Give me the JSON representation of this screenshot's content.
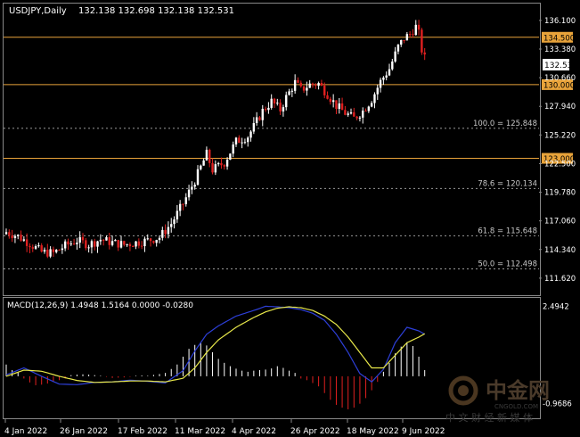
{
  "chart_data": [
    {
      "type": "candlestick",
      "title": "USDJPY,Daily",
      "ohlc_readout": "132.138 132.698 132.138 132.531",
      "last_price": "132.531",
      "ylim": [
        110.0,
        137.7
      ],
      "y_ticks": [
        "136.100",
        "133.380",
        "130.660",
        "127.940",
        "125.220",
        "122.500",
        "119.780",
        "117.060",
        "114.340",
        "111.620"
      ],
      "x_labels": [
        "4 Jan 2022",
        "26 Jan 2022",
        "17 Feb 2022",
        "11 Mar 2022",
        "4 Apr 2022",
        "26 Apr 2022",
        "18 May 2022",
        "9 Jun 2022"
      ],
      "horizontal_levels": [
        {
          "value": 134.5,
          "label": "134.500",
          "color": "#e8a33a"
        },
        {
          "value": 130.0,
          "label": "130.000",
          "color": "#e8a33a"
        },
        {
          "value": 123.0,
          "label": "123.000",
          "color": "#e8a33a"
        }
      ],
      "fibonacci_levels": [
        {
          "value": 125.848,
          "label": "100.0 = 125.848"
        },
        {
          "value": 120.134,
          "label": "78.6 = 120.134"
        },
        {
          "value": 115.648,
          "label": "61.8 = 115.648"
        },
        {
          "value": 112.498,
          "label": "50.0 = 112.498"
        }
      ],
      "close_path": [
        [
          0,
          116.0
        ],
        [
          4,
          115.6
        ],
        [
          8,
          114.9
        ],
        [
          12,
          114.1
        ],
        [
          16,
          114.0
        ],
        [
          20,
          114.7
        ],
        [
          24,
          115.2
        ],
        [
          28,
          114.8
        ],
        [
          32,
          115.3
        ],
        [
          36,
          115.0
        ],
        [
          40,
          114.8
        ],
        [
          44,
          115.0
        ],
        [
          48,
          115.2
        ],
        [
          52,
          115.5
        ],
        [
          56,
          116.8
        ],
        [
          60,
          118.7
        ],
        [
          64,
          120.9
        ],
        [
          68,
          123.4
        ],
        [
          70,
          121.9
        ],
        [
          74,
          122.6
        ],
        [
          78,
          124.6
        ],
        [
          82,
          125.1
        ],
        [
          84,
          126.0
        ],
        [
          87,
          127.5
        ],
        [
          90,
          128.4
        ],
        [
          93,
          127.6
        ],
        [
          95,
          128.8
        ],
        [
          98,
          130.2
        ],
        [
          100,
          129.5
        ],
        [
          103,
          130.0
        ],
        [
          106,
          130.1
        ],
        [
          109,
          129.1
        ],
        [
          112,
          128.0
        ],
        [
          115,
          127.3
        ],
        [
          118,
          126.8
        ],
        [
          121,
          127.5
        ],
        [
          124,
          128.6
        ],
        [
          127,
          130.3
        ],
        [
          130,
          131.5
        ],
        [
          133,
          133.6
        ],
        [
          135,
          134.4
        ],
        [
          137,
          134.8
        ],
        [
          139,
          135.5
        ],
        [
          140,
          134.8
        ],
        [
          141,
          133.3
        ],
        [
          142,
          132.5
        ]
      ],
      "accent": "#e8a33a",
      "bull_color": "#ffffff",
      "bear_color": "#e02020"
    },
    {
      "type": "macd",
      "label": "MACD(12,26,9) 1.4948 1.5164 0.0000 -0.0280",
      "ylim": [
        -1.5,
        2.8
      ],
      "y_ticks": [
        "2.4942",
        "-0.9686"
      ],
      "macd_path": [
        [
          0,
          0.05
        ],
        [
          6,
          0.3
        ],
        [
          12,
          0.0
        ],
        [
          18,
          -0.28
        ],
        [
          24,
          -0.3
        ],
        [
          30,
          -0.22
        ],
        [
          36,
          -0.2
        ],
        [
          42,
          -0.14
        ],
        [
          48,
          -0.18
        ],
        [
          54,
          -0.24
        ],
        [
          60,
          0.2
        ],
        [
          64,
          0.9
        ],
        [
          68,
          1.5
        ],
        [
          72,
          1.8
        ],
        [
          78,
          2.15
        ],
        [
          84,
          2.35
        ],
        [
          88,
          2.5
        ],
        [
          92,
          2.48
        ],
        [
          96,
          2.45
        ],
        [
          100,
          2.38
        ],
        [
          104,
          2.25
        ],
        [
          108,
          2.0
        ],
        [
          112,
          1.5
        ],
        [
          116,
          0.85
        ],
        [
          120,
          0.1
        ],
        [
          124,
          -0.2
        ],
        [
          128,
          0.25
        ],
        [
          132,
          1.2
        ],
        [
          136,
          1.75
        ],
        [
          140,
          1.62
        ],
        [
          142,
          1.5
        ]
      ],
      "signal_path": [
        [
          0,
          0.0
        ],
        [
          6,
          0.22
        ],
        [
          12,
          0.18
        ],
        [
          18,
          0.0
        ],
        [
          24,
          -0.15
        ],
        [
          30,
          -0.22
        ],
        [
          36,
          -0.2
        ],
        [
          42,
          -0.17
        ],
        [
          48,
          -0.17
        ],
        [
          54,
          -0.2
        ],
        [
          60,
          -0.07
        ],
        [
          64,
          0.3
        ],
        [
          68,
          0.85
        ],
        [
          72,
          1.3
        ],
        [
          78,
          1.75
        ],
        [
          84,
          2.1
        ],
        [
          88,
          2.3
        ],
        [
          92,
          2.43
        ],
        [
          96,
          2.48
        ],
        [
          100,
          2.45
        ],
        [
          104,
          2.35
        ],
        [
          108,
          2.15
        ],
        [
          112,
          1.85
        ],
        [
          116,
          1.4
        ],
        [
          120,
          0.85
        ],
        [
          124,
          0.3
        ],
        [
          128,
          0.3
        ],
        [
          132,
          0.75
        ],
        [
          136,
          1.2
        ],
        [
          140,
          1.4
        ],
        [
          142,
          1.52
        ]
      ],
      "histogram_bars": [
        [
          0,
          0.42
        ],
        [
          2,
          0.22
        ],
        [
          4,
          0.14
        ],
        [
          6,
          -0.08
        ],
        [
          8,
          -0.22
        ],
        [
          10,
          -0.32
        ],
        [
          12,
          -0.3
        ],
        [
          14,
          -0.26
        ],
        [
          16,
          -0.2
        ],
        [
          18,
          -0.14
        ],
        [
          20,
          -0.08
        ],
        [
          22,
          0.04
        ],
        [
          24,
          0.06
        ],
        [
          26,
          0.07
        ],
        [
          28,
          0.06
        ],
        [
          30,
          0.04
        ],
        [
          32,
          0.02
        ],
        [
          34,
          -0.02
        ],
        [
          36,
          -0.06
        ],
        [
          38,
          -0.05
        ],
        [
          40,
          -0.04
        ],
        [
          42,
          -0.02
        ],
        [
          44,
          0.02
        ],
        [
          46,
          0.03
        ],
        [
          48,
          0.02
        ],
        [
          50,
          0.05
        ],
        [
          52,
          0.08
        ],
        [
          54,
          0.12
        ],
        [
          56,
          0.26
        ],
        [
          58,
          0.42
        ],
        [
          60,
          0.7
        ],
        [
          62,
          0.98
        ],
        [
          64,
          1.12
        ],
        [
          66,
          1.2
        ],
        [
          68,
          1.1
        ],
        [
          70,
          0.86
        ],
        [
          72,
          0.62
        ],
        [
          74,
          0.48
        ],
        [
          76,
          0.36
        ],
        [
          78,
          0.27
        ],
        [
          80,
          0.2
        ],
        [
          82,
          0.16
        ],
        [
          84,
          0.2
        ],
        [
          86,
          0.22
        ],
        [
          88,
          0.24
        ],
        [
          90,
          0.28
        ],
        [
          92,
          0.36
        ],
        [
          94,
          0.3
        ],
        [
          96,
          0.2
        ],
        [
          98,
          0.12
        ],
        [
          100,
          -0.08
        ],
        [
          102,
          -0.14
        ],
        [
          104,
          -0.24
        ],
        [
          106,
          -0.36
        ],
        [
          108,
          -0.6
        ],
        [
          110,
          -0.84
        ],
        [
          112,
          -1.02
        ],
        [
          114,
          -1.12
        ],
        [
          116,
          -1.18
        ],
        [
          118,
          -1.12
        ],
        [
          120,
          -0.98
        ],
        [
          122,
          -0.78
        ],
        [
          124,
          -0.5
        ],
        [
          126,
          -0.2
        ],
        [
          128,
          0.16
        ],
        [
          130,
          0.48
        ],
        [
          132,
          0.82
        ],
        [
          134,
          1.06
        ],
        [
          136,
          1.22
        ],
        [
          138,
          1.08
        ],
        [
          140,
          0.7
        ],
        [
          142,
          0.22
        ]
      ],
      "macd_color": "#2d3fd8",
      "signal_color": "#e8e84a",
      "hist_pos_color": "#ffffff",
      "hist_neg_color": "#e02020"
    }
  ],
  "watermark": {
    "cn_logo": "中金网",
    "domain": "CNGOLD.COM",
    "tagline": "中 文 财 经 新 媒 体"
  }
}
